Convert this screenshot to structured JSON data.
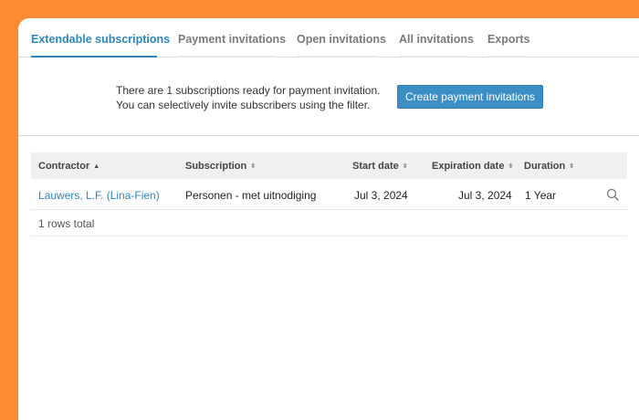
{
  "tabs": [
    {
      "label": "Extendable subscriptions",
      "active": true
    },
    {
      "label": "Payment invitations",
      "active": false
    },
    {
      "label": "Open invitations",
      "active": false
    },
    {
      "label": "All invitations",
      "active": false
    },
    {
      "label": "Exports",
      "active": false
    }
  ],
  "invite": {
    "line1": "There are 1 subscriptions ready for payment invitation.",
    "line2": "You can selectively invite subscribers using the filter.",
    "button_label": "Create payment invitations"
  },
  "table": {
    "columns": [
      "Contractor",
      "Subscription",
      "Start date",
      "Expiration date",
      "Duration"
    ],
    "rows": [
      {
        "contractor": "Lauwers, L.F. (Lina-Fien)",
        "subscription": "Personen - met uitnodiging",
        "start_date": "Jul 3, 2024",
        "expiration_date": "Jul 3, 2024",
        "duration": "1 Year"
      }
    ],
    "total_label": "1 rows total"
  },
  "colors": {
    "background": "#ff8a34",
    "accent": "#2f86b9",
    "button": "#3b8fc5"
  }
}
